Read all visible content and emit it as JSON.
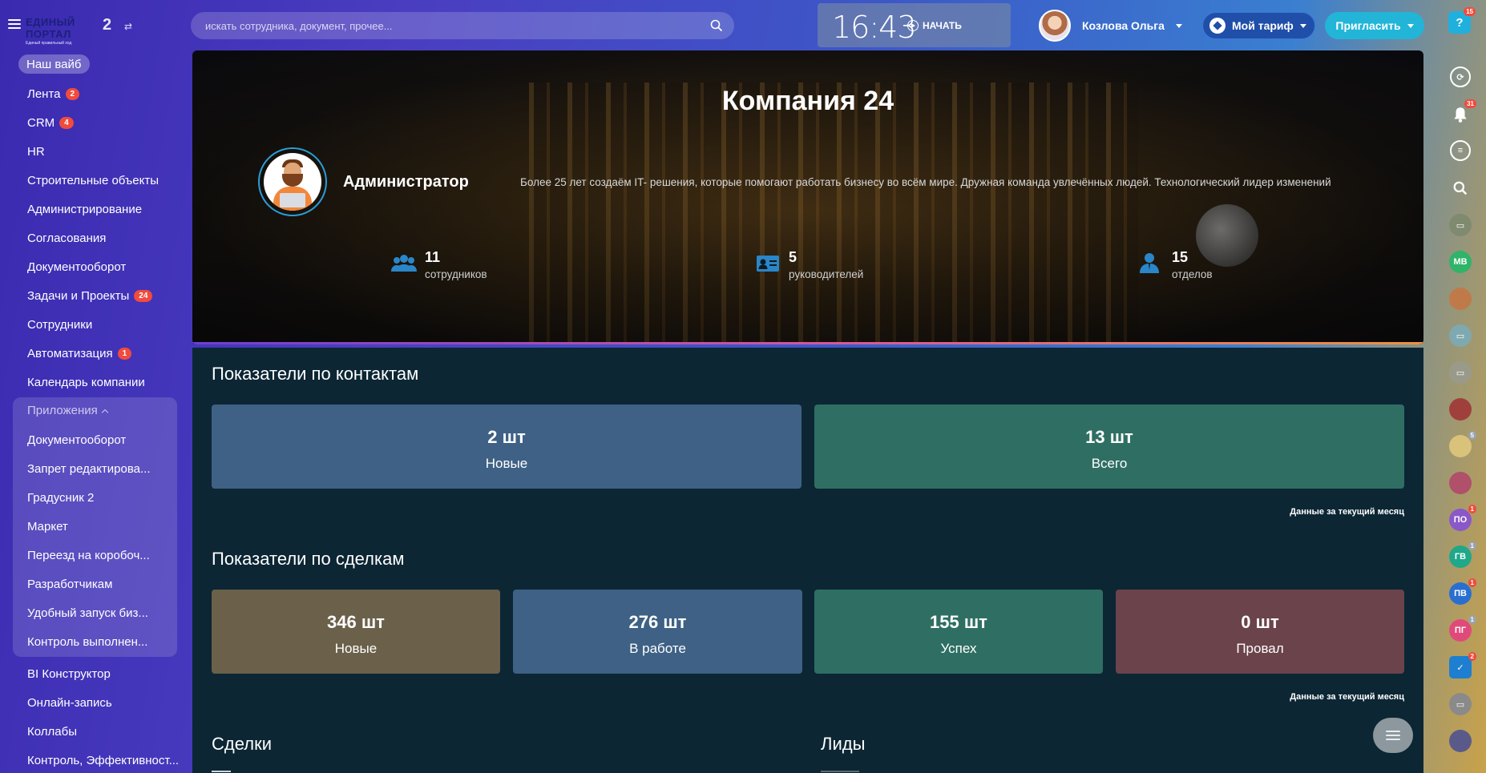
{
  "topbar": {
    "logo_title": "ЕДИНЫЙ ПОРТАЛ",
    "logo_subtitle": "Единый правильный ход",
    "logo_number": "2",
    "search_placeholder": "искать сотрудника, документ, прочее...",
    "clock_time": "16:43",
    "start_label": "НАЧАТЬ",
    "user_name": "Козлова Ольга",
    "tariff_label": "Мой тариф",
    "invite_label": "Пригласить",
    "help_label": "?",
    "help_badge": "15"
  },
  "sidebar": {
    "active_item": "Наш вайб",
    "items": [
      {
        "label": "Лента",
        "badge": "2"
      },
      {
        "label": "CRM",
        "badge": "4"
      },
      {
        "label": "HR",
        "badge": ""
      },
      {
        "label": "Строительные объекты",
        "badge": ""
      },
      {
        "label": "Администрирование",
        "badge": ""
      },
      {
        "label": "Согласования",
        "badge": ""
      },
      {
        "label": "Документооборот",
        "badge": ""
      },
      {
        "label": "Задачи и Проекты",
        "badge": "24"
      },
      {
        "label": "Сотрудники",
        "badge": ""
      },
      {
        "label": "Автоматизация",
        "badge": "1"
      },
      {
        "label": "Календарь компании",
        "badge": ""
      }
    ],
    "apps_header": "Приложения",
    "apps": [
      "Документооборот",
      "Запрет редактирова...",
      "Градусник 2",
      "Маркет",
      "Переезд на коробоч...",
      "Разработчикам",
      "Удобный запуск биз...",
      "Контроль выполнен..."
    ],
    "bottom_items": [
      "BI Конструктор",
      "Онлайн-запись",
      "Коллабы",
      "Контроль, Эффективност..."
    ]
  },
  "hero": {
    "title": "Компания 24",
    "admin_name": "Администратор",
    "description": "Более 25 лет создаём IT- решения, которые помогают работать бизнесу во всём мире. Дружная команда увлечённых людей. Технологический лидер изменений",
    "stats": [
      {
        "icon": "users-icon",
        "value": "11",
        "label": "сотрудников"
      },
      {
        "icon": "id-card-icon",
        "value": "5",
        "label": "руководителей"
      },
      {
        "icon": "user-tie-icon",
        "value": "15",
        "label": "отделов"
      }
    ]
  },
  "contacts": {
    "title": "Показатели по контактам",
    "cards": [
      {
        "value": "2 шт",
        "label": "Новые",
        "color": "#3e6185"
      },
      {
        "value": "13 шт",
        "label": "Всего",
        "color": "#2f6f63"
      }
    ],
    "note": "Данные за текущий месяц"
  },
  "deals": {
    "title": "Показатели по сделкам",
    "cards": [
      {
        "value": "346 шт",
        "label": "Новые",
        "color": "#6b604a"
      },
      {
        "value": "276 шт",
        "label": "В работе",
        "color": "#3e6185"
      },
      {
        "value": "155 шт",
        "label": "Успех",
        "color": "#2f6f63"
      },
      {
        "value": "0 шт",
        "label": "Провал",
        "color": "#6b434b"
      }
    ],
    "note": "Данные за текущий месяц"
  },
  "lower": {
    "deals_title": "Сделки",
    "leads_title": "Лиды"
  },
  "rightbar": {
    "items": [
      {
        "icon": "copilot-icon",
        "text": "",
        "badge": ""
      },
      {
        "icon": "bell-icon",
        "text": "",
        "badge": "31"
      },
      {
        "icon": "chat-icon",
        "text": "",
        "badge": ""
      },
      {
        "icon": "search-icon",
        "text": "",
        "badge": ""
      },
      {
        "icon": "contact-card-icon",
        "text": "",
        "badge": ""
      },
      {
        "icon": "avatar-mb",
        "text": "MB",
        "badge": ""
      },
      {
        "icon": "avatar-user-1",
        "text": "",
        "badge": ""
      },
      {
        "icon": "chat-bubble-icon",
        "text": "",
        "badge": ""
      },
      {
        "icon": "contact-card-icon",
        "text": "",
        "badge": ""
      },
      {
        "icon": "avatar-user-2",
        "text": "",
        "badge": ""
      },
      {
        "icon": "avatar-builder",
        "text": "",
        "badge": "5"
      },
      {
        "icon": "avatar-user-3",
        "text": "",
        "badge": ""
      },
      {
        "icon": "avatar-po",
        "text": "ПО",
        "badge": "1"
      },
      {
        "icon": "avatar-gv",
        "text": "ГВ",
        "badge": "1"
      },
      {
        "icon": "avatar-pv",
        "text": "ПВ",
        "badge": "1"
      },
      {
        "icon": "avatar-pg",
        "text": "ПГ",
        "badge": "1"
      },
      {
        "icon": "tasks-icon",
        "text": "",
        "badge": "2"
      },
      {
        "icon": "contact-card-icon",
        "text": "",
        "badge": ""
      },
      {
        "icon": "avatar-group",
        "text": "",
        "badge": ""
      }
    ]
  }
}
